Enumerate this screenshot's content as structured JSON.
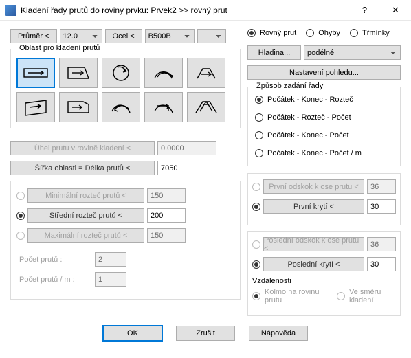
{
  "title": "Kladení řady prutů do roviny prvku: Prvek2 >> rovný prut",
  "toolbar": {
    "diameter_btn": "Průměr <",
    "diameter_val": "12.0",
    "steel_btn": "Ocel <",
    "steel_val": "B500B"
  },
  "shape_group": "Oblast pro kladení prutů",
  "type": {
    "straight": "Rovný prut",
    "bends": "Ohyby",
    "stirrups": "Třmínky"
  },
  "layer_btn": "Hladina...",
  "layer_val": "podélné",
  "view_btn": "Nastavení pohledu...",
  "method": {
    "title": "Způsob zadání řady",
    "o1": "Počátek - Konec - Rozteč",
    "o2": "Počátek - Rozteč - Počet",
    "o3": "Počátek - Konec - Počet",
    "o4": "Počátek - Konec - Počet / m"
  },
  "angle_lbl": "Úhel prutu v rovině kladení <",
  "angle_val": "0.0000",
  "width_lbl": "Šířka oblasti = Délka prutů <",
  "width_val": "7050",
  "spacing": {
    "min_lbl": "Minimální rozteč prutů <",
    "min_val": "150",
    "mid_lbl": "Střední rozteč prutů <",
    "mid_val": "200",
    "max_lbl": "Maximální rozteč prutů <",
    "max_val": "150"
  },
  "count_lbl": "Počet prutů :",
  "count_val": "2",
  "countm_lbl": "Počet prutů / m :",
  "countm_val": "1",
  "offsets": {
    "first_off_lbl": "První odskok k ose prutu <",
    "first_off_val": "36",
    "first_cov_lbl": "První krytí <",
    "first_cov_val": "30",
    "last_off_lbl": "Poslední odskok k ose prutu <",
    "last_off_val": "36",
    "last_cov_lbl": "Poslední krytí <",
    "last_cov_val": "30"
  },
  "dist": {
    "title": "Vzdálenosti",
    "perp": "Kolmo na rovinu prutu",
    "along": "Ve směru kladení"
  },
  "btns": {
    "ok": "OK",
    "cancel": "Zrušit",
    "help": "Nápověda"
  }
}
